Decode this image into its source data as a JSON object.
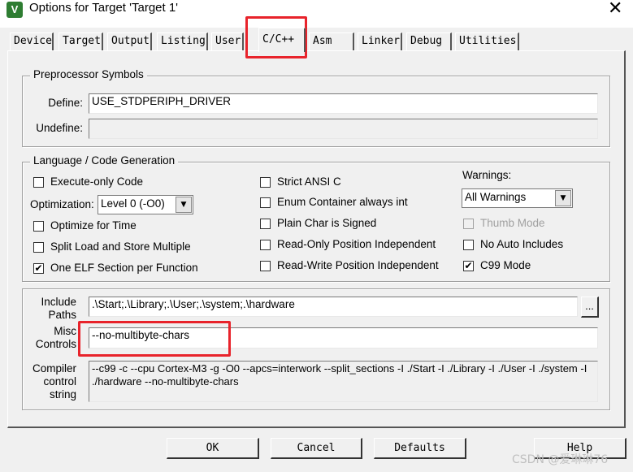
{
  "window": {
    "title": "Options for Target 'Target 1'",
    "icon": "uvision-icon",
    "close": "✕"
  },
  "tabs": [
    "Device",
    "Target",
    "Output",
    "Listing",
    "User",
    "C/C++",
    "Asm",
    "Linker",
    "Debug",
    "Utilities"
  ],
  "active_tab": "C/C++",
  "preprocessor": {
    "title": "Preprocessor Symbols",
    "define_label": "Define:",
    "define_value": "USE_STDPERIPH_DRIVER",
    "undefine_label": "Undefine:",
    "undefine_value": ""
  },
  "language": {
    "title": "Language / Code Generation",
    "execute_only": {
      "label": "Execute-only Code",
      "checked": false
    },
    "optimization_label": "Optimization:",
    "optimization_value": "Level 0 (-O0)",
    "optimize_time": {
      "label": "Optimize for Time",
      "checked": false
    },
    "split_load": {
      "label": "Split Load and Store Multiple",
      "checked": false
    },
    "one_elf": {
      "label": "One ELF Section per Function",
      "checked": true,
      "mark": "✔"
    },
    "strict_ansi": {
      "label": "Strict ANSI C",
      "checked": false
    },
    "enum_container": {
      "label": "Enum Container always int",
      "checked": false
    },
    "plain_char": {
      "label": "Plain Char is Signed",
      "checked": false
    },
    "ro_pi": {
      "label": "Read-Only Position Independent",
      "checked": false
    },
    "rw_pi": {
      "label": "Read-Write Position Independent",
      "checked": false
    },
    "warnings_label": "Warnings:",
    "warnings_value": "All Warnings",
    "thumb_mode": {
      "label": "Thumb Mode",
      "checked": false,
      "disabled": true
    },
    "no_auto_includes": {
      "label": "No Auto Includes",
      "checked": false
    },
    "c99_mode": {
      "label": "C99 Mode",
      "checked": true,
      "mark": "✔"
    }
  },
  "include_paths": {
    "label_line1": "Include",
    "label_line2": "Paths",
    "value": ".\\Start;.\\Library;.\\User;.\\system;.\\hardware",
    "browse": "..."
  },
  "misc_controls": {
    "label_line1": "Misc",
    "label_line2": "Controls",
    "value": "--no-multibyte-chars"
  },
  "compiler_control": {
    "label_line1": "Compiler",
    "label_line2": "control",
    "label_line3": "string",
    "value": "--c99 -c --cpu Cortex-M3 -g -O0 --apcs=interwork --split_sections -I ./Start -I ./Library -I ./User -I ./system -I ./hardware --no-multibyte-chars"
  },
  "buttons": {
    "ok": "OK",
    "cancel": "Cancel",
    "defaults": "Defaults",
    "help": "Help"
  },
  "watermark": "CSDN @爱琳琳76",
  "colors": {
    "highlight": "#e8232b",
    "dialog_bg": "#f0f0f0"
  }
}
